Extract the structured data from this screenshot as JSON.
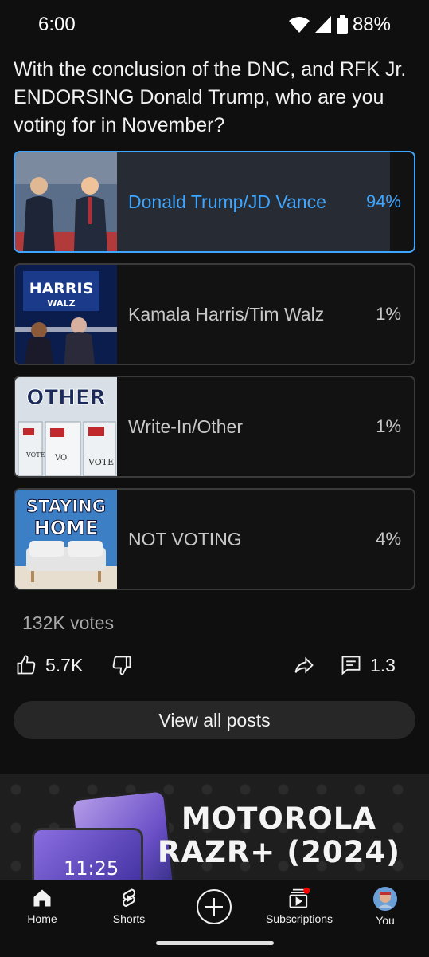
{
  "status": {
    "time": "6:00",
    "battery": "88%"
  },
  "post": {
    "question": "With the conclusion of the DNC, and RFK Jr. ENDORSING Donald Trump, who are you voting for in November?",
    "options": [
      {
        "label": "Donald Trump/JD Vance",
        "percent": "94%",
        "fill": 0.94,
        "selected": true
      },
      {
        "label": "Kamala Harris/Tim Walz",
        "percent": "1%",
        "fill": 0.01,
        "selected": false,
        "thumb_text": [
          "HARRIS",
          "WALZ"
        ]
      },
      {
        "label": "Write-In/Other",
        "percent": "1%",
        "fill": 0.01,
        "selected": false,
        "thumb_text": [
          "OTHER",
          "VOTE",
          "VO",
          "VOTE"
        ]
      },
      {
        "label": "NOT VOTING",
        "percent": "4%",
        "fill": 0.04,
        "selected": false,
        "thumb_text": [
          "STAYING",
          "HOME"
        ]
      }
    ],
    "votes": "132K votes",
    "likes": "5.7K",
    "comments": "1.3",
    "view_all": "View all posts"
  },
  "ad": {
    "line1": "MOTOROLA",
    "line2": "RAZR+ (2024)",
    "phone_time": "11:25"
  },
  "nav": {
    "home": "Home",
    "shorts": "Shorts",
    "subscriptions": "Subscriptions",
    "you": "You"
  },
  "colors": {
    "accent": "#3ea6ff",
    "background": "#0f0f0f",
    "notification": "#ff0000"
  }
}
